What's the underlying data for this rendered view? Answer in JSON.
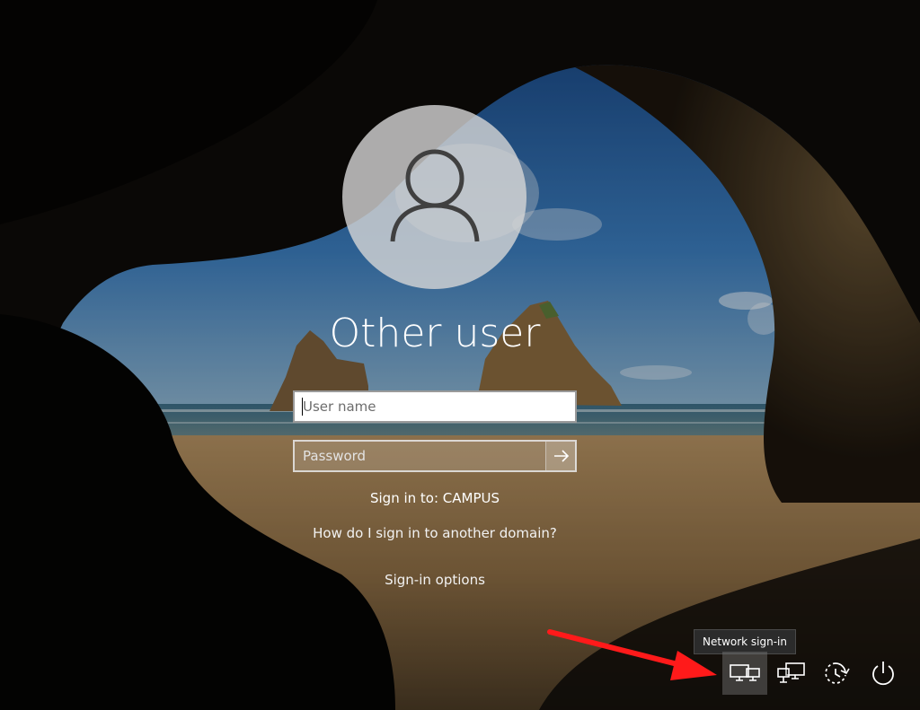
{
  "login": {
    "title": "Other user",
    "username_placeholder": "User name",
    "password_placeholder": "Password",
    "sign_in_to": "Sign in to: CAMPUS",
    "other_domain_link": "How do I sign in to another domain?",
    "sign_in_options": "Sign-in options"
  },
  "corner": {
    "tooltip": "Network sign-in"
  },
  "colors": {
    "annotation_arrow": "#ff1a1a",
    "sky": "#2e6fb0",
    "sand": "#a8875a"
  },
  "icons": {
    "avatar": "user-icon",
    "submit": "arrow-right-icon",
    "network_signin": "network-sign-in-icon",
    "network": "network-icon",
    "ease_of_access": "ease-of-access-icon",
    "power": "power-icon"
  }
}
